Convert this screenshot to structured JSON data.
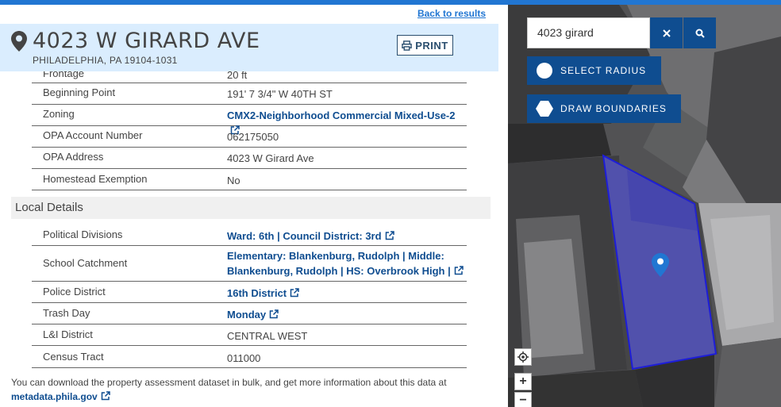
{
  "back_link": "Back to results",
  "header": {
    "title": "4023 W GIRARD AVE",
    "subtitle": "PHILADELPHIA, PA 19104-1031",
    "print_label": "PRINT"
  },
  "property_rows": [
    {
      "label": "Frontage",
      "value": "20 ft"
    },
    {
      "label": "Beginning Point",
      "value": "191' 7 3/4\" W 40TH ST"
    },
    {
      "label": "Zoning",
      "value": "CMX2-Neighborhood Commercial Mixed-Use-2"
    },
    {
      "label": "OPA Account Number",
      "value": "062175050"
    },
    {
      "label": "OPA Address",
      "value": "4023 W Girard Ave"
    },
    {
      "label": "Homestead Exemption",
      "value": "No"
    }
  ],
  "local_section_title": "Local Details",
  "local_rows": [
    {
      "label": "Political Divisions",
      "value": "Ward: 6th | Council District: 3rd"
    },
    {
      "label": "School Catchment",
      "value": "Elementary: Blankenburg, Rudolph | Middle: Blankenburg, Rudolph | HS: Overbrook High |"
    },
    {
      "label": "Police District",
      "value": "16th District"
    },
    {
      "label": "Trash Day",
      "value": "Monday"
    },
    {
      "label": "L&I District",
      "value": "CENTRAL WEST"
    },
    {
      "label": "Census Tract",
      "value": "011000"
    }
  ],
  "footnote": {
    "text": "You can download the property assessment dataset in bulk, and get more information about this data at",
    "link": "metadata.phila.gov"
  },
  "map": {
    "search_value": "4023 girard",
    "select_radius_label": "SELECT RADIUS",
    "draw_boundaries_label": "DRAW BOUNDARIES",
    "zoom_in": "+",
    "zoom_out": "−"
  },
  "colors": {
    "brand_blue": "#2176d2",
    "dark_blue": "#0f4d90",
    "header_bg": "#daedfe",
    "parcel_fill": "#5b5bff"
  }
}
